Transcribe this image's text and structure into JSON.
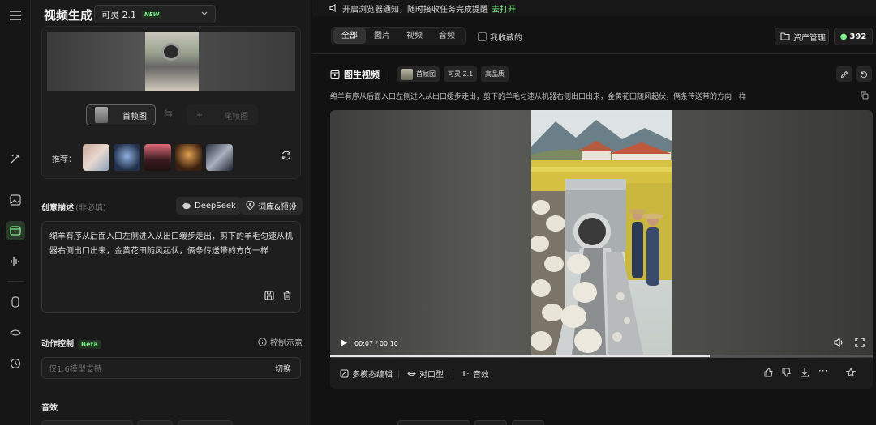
{
  "panel": {
    "title": "视频生成",
    "model": "可灵 2.1",
    "model_badge": "NEW",
    "first_frame_label": "首帧图",
    "last_frame_label": "尾帧图",
    "recommend_label": "推荐：",
    "creative_label": "创意描述",
    "creative_sub": "(非必填)",
    "deepseek_label": "DeepSeek",
    "lexicon_label": "词库&预设",
    "prompt_text": "绵羊有序从后面入口左侧进入从出口缓步走出，剪下的羊毛匀速从机器右侧出口出来，金黄花田随风起伏，俩条传送带的方向一样",
    "motion_label": "动作控制",
    "motion_badge": "Beta",
    "motion_hint": "控制示意",
    "motion_placeholder": "仅1.6模型支持",
    "motion_switch": "切换",
    "sound_label": "音效"
  },
  "main": {
    "notice_text": "开启浏览器通知，随时接收任务完成提醒",
    "notice_link": "去打开",
    "tabs": [
      "全部",
      "图片",
      "视频",
      "音频"
    ],
    "favorites_label": "我收藏的",
    "asset_label": "资产管理",
    "points": "392",
    "card": {
      "title": "图生视频",
      "tag_frame": "首帧图",
      "tag_model": "可灵 2.1",
      "tag_quality": "高品质",
      "prompt": "绵羊有序从后面入口左侧进入从出口缓步走出，剪下的羊毛匀速从机器右侧出口出来，金黄花田随风起伏，俩条传送带的方向一样",
      "time": "00:07 / 00:10",
      "progress": 0.7,
      "actions": {
        "multimodal": "多模态编辑",
        "lipsync": "对口型",
        "sound": "音效"
      }
    }
  },
  "colors": {
    "accent": "#7cf08a",
    "background": "#121212",
    "panel": "#1a1a1a"
  }
}
